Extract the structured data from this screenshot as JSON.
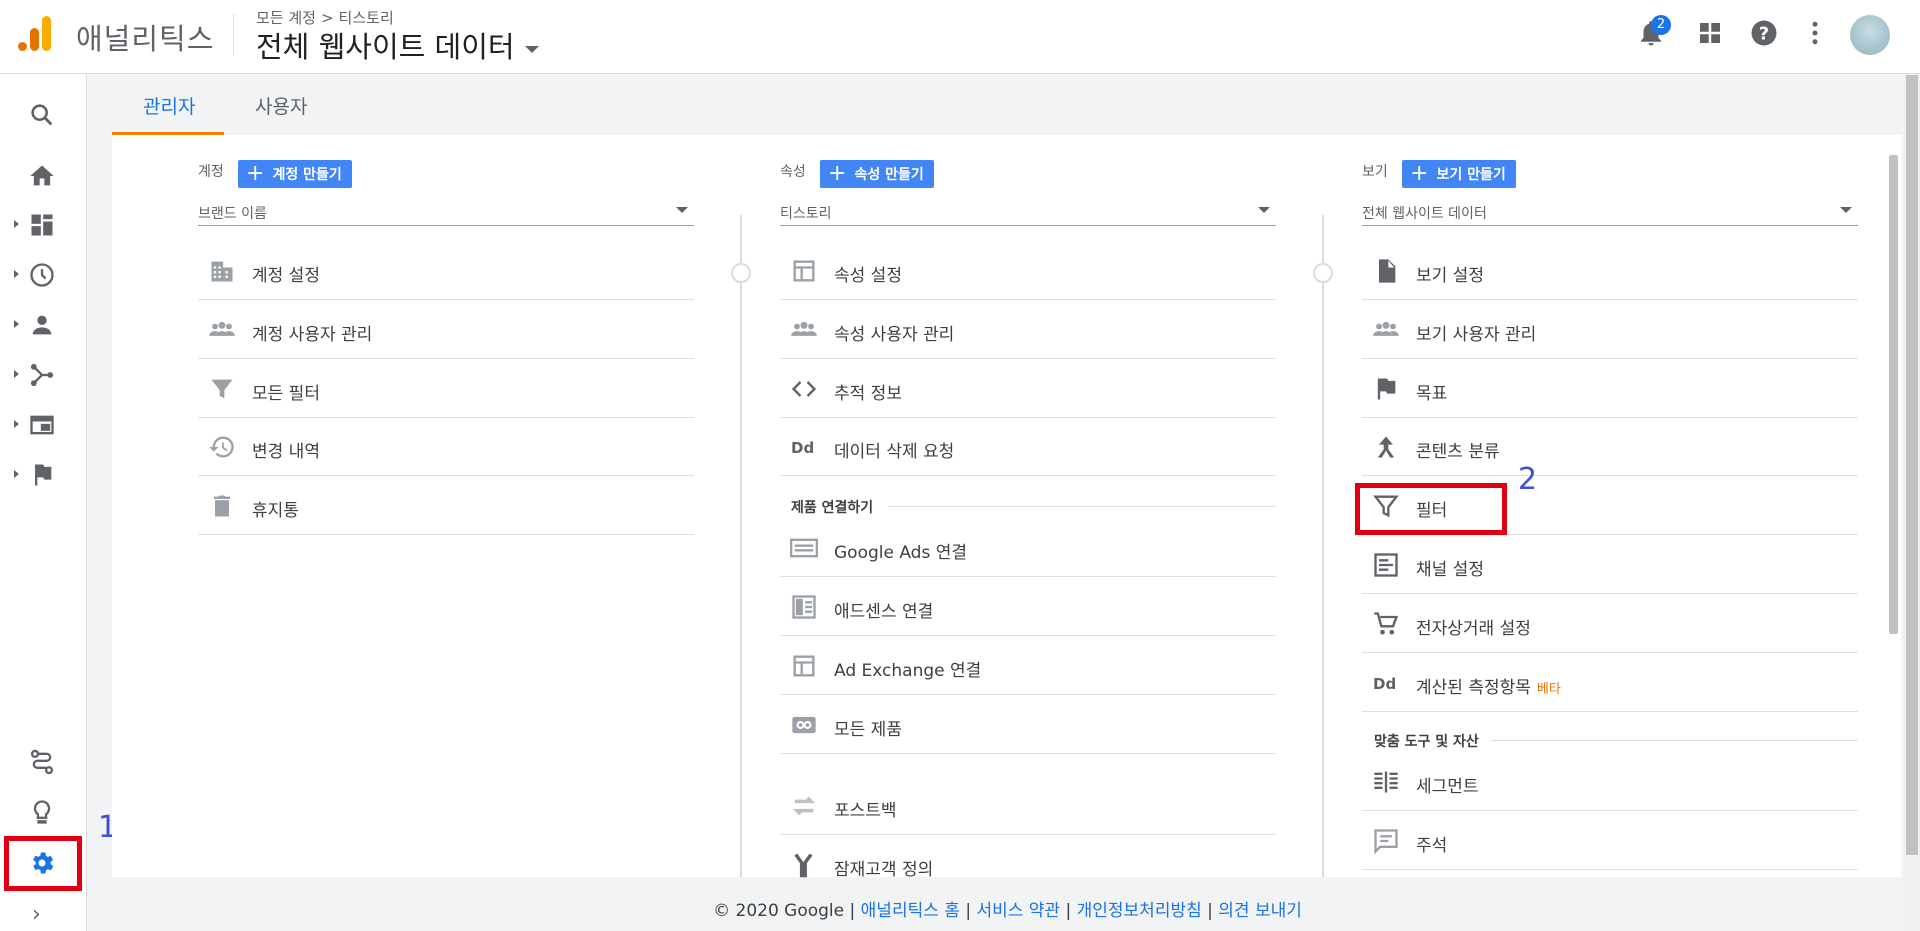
{
  "header": {
    "app_name": "애널리틱스",
    "breadcrumb_account": "모든 계정",
    "breadcrumb_sep": ">",
    "breadcrumb_property": "티스토리",
    "view_title": "전체 웹사이트 데이터",
    "notification_count": "2",
    "icons": [
      "notification-bell-icon",
      "apps-grid-icon",
      "help-icon",
      "more-vert-icon"
    ]
  },
  "tabs": [
    {
      "label": "관리자",
      "active": true
    },
    {
      "label": "사용자",
      "active": false
    }
  ],
  "account_col": {
    "heading": "계정",
    "create_label": "계정 만들기",
    "select_value": "브랜드 이름",
    "items": [
      "계정 설정",
      "계정 사용자 관리",
      "모든 필터",
      "변경 내역",
      "휴지통"
    ]
  },
  "property_col": {
    "heading": "속성",
    "create_label": "속성 만들기",
    "select_value": "티스토리",
    "items": [
      "속성 설정",
      "속성 사용자 관리",
      "추적 정보",
      "데이터 삭제 요청"
    ],
    "section_title": "제품 연결하기",
    "linked_items": [
      "Google Ads 연결",
      "애드센스 연결",
      "Ad Exchange 연결",
      "모든 제품"
    ],
    "more_items": [
      "포스트백",
      "잠재고객 정의"
    ]
  },
  "view_col": {
    "heading": "보기",
    "create_label": "보기 만들기",
    "select_value": "전체 웹사이트 데이터",
    "items": [
      "보기 설정",
      "보기 사용자 관리",
      "목표",
      "콘텐츠 분류",
      "필터",
      "채널 설정",
      "전자상거래 설정",
      "계산된 측정항목"
    ],
    "beta_label": "베타",
    "section_title": "맞춤 도구 및 자산",
    "custom_items": [
      "세그먼트",
      "주석"
    ]
  },
  "annotations": {
    "label_1": "1",
    "label_2": "2"
  },
  "footer": {
    "copyright": "© 2020 Google",
    "sep": " | ",
    "links": [
      "애널리틱스 홈",
      "서비스 약관",
      "개인정보처리방침",
      "의견 보내기"
    ]
  },
  "colors": {
    "accent": "#1a73e8",
    "button": "#4285f4",
    "highlight_box": "#e00012",
    "annotation": "#3c4fd6",
    "tab_underline": "#f57c00"
  }
}
